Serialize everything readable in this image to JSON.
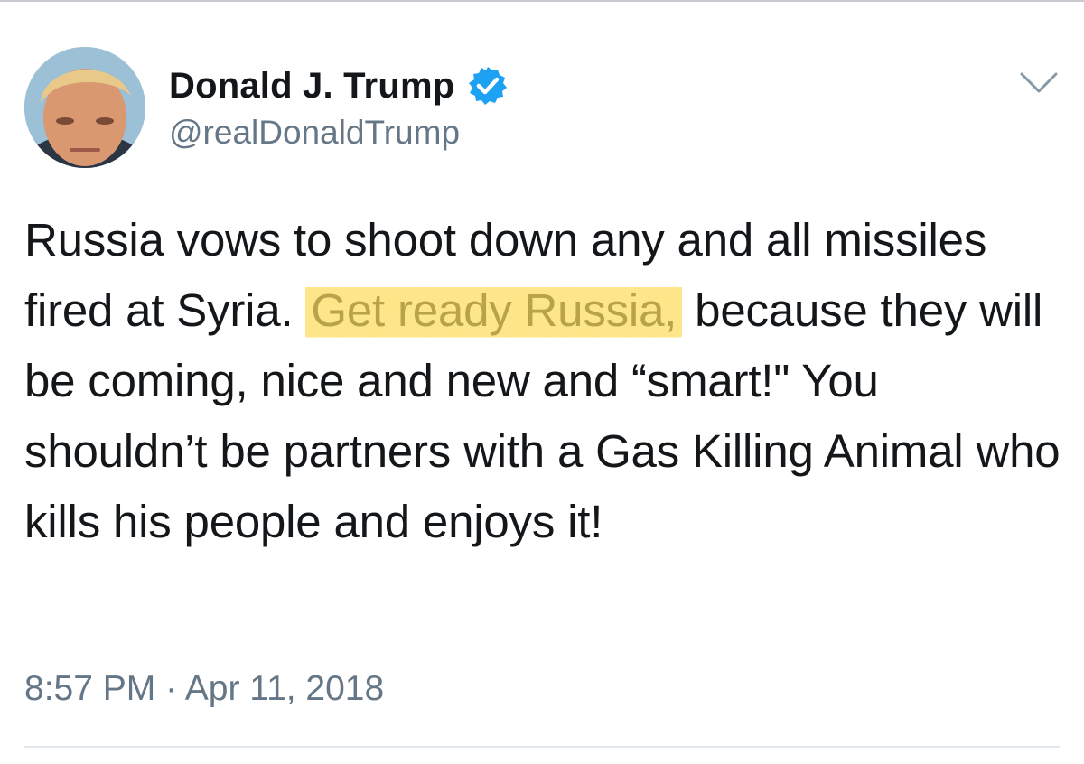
{
  "tweet": {
    "author": {
      "display_name": "Donald J. Trump",
      "handle": "@realDonaldTrump",
      "verified": true
    },
    "text_segments": [
      {
        "text": "Russia vows to shoot down any and all missiles fired at Syria. ",
        "highlighted": false
      },
      {
        "text": "Get ready Russia,",
        "highlighted": true
      },
      {
        "text": " because they will be coming, nice and new and “smart!\" You shouldn’t be partners with a Gas Killing Animal who kills his people and enjoys it!",
        "highlighted": false
      }
    ],
    "timestamp": "8:57 PM · Apr 11, 2018"
  },
  "icons": {
    "verified": "verified-badge-icon",
    "menu": "chevron-down-icon"
  },
  "colors": {
    "verified_blue": "#1da1f2",
    "secondary_text": "#657786",
    "primary_text": "#14171a",
    "highlight": "#fde274"
  }
}
